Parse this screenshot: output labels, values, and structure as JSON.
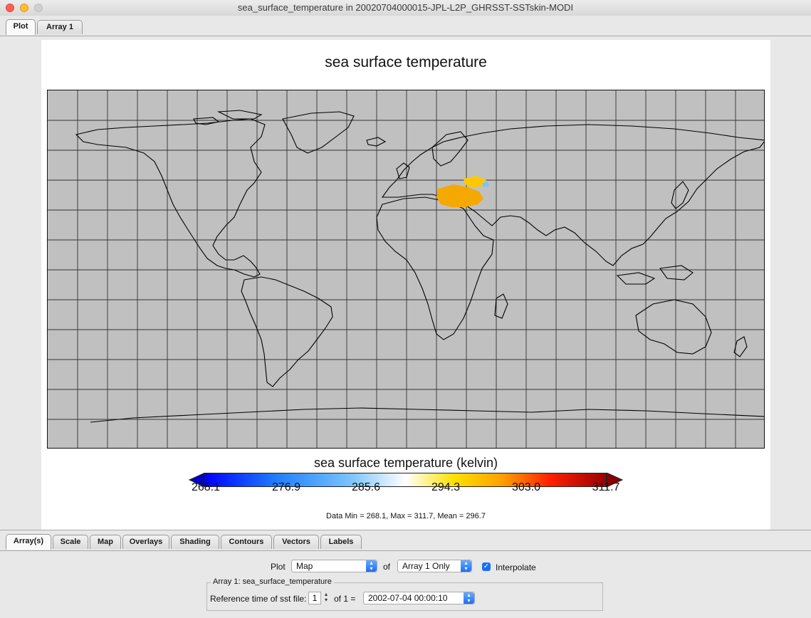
{
  "window": {
    "title": "sea_surface_temperature in 20020704000015-JPL-L2P_GHRSST-SSTskin-MODI"
  },
  "top_tabs": [
    {
      "label": "Plot",
      "active": true
    },
    {
      "label": "Array 1",
      "active": false
    }
  ],
  "plot": {
    "title": "sea surface temperature",
    "colorbar": {
      "title": "sea surface temperature (kelvin)",
      "ticks": [
        "268.1",
        "276.9",
        "285.6",
        "294.3",
        "303.0",
        "311.7"
      ],
      "colors": [
        "#0000ff",
        "#2080ff",
        "#79c3ff",
        "#ffffff",
        "#ffe000",
        "#ffa000",
        "#ff2000",
        "#990000"
      ]
    },
    "stats": "Data Min = 268.1, Max = 311.7, Mean = 296.7"
  },
  "bottom_tabs": [
    {
      "label": "Array(s)",
      "active": true
    },
    {
      "label": "Scale"
    },
    {
      "label": "Map"
    },
    {
      "label": "Overlays"
    },
    {
      "label": "Shading"
    },
    {
      "label": "Contours"
    },
    {
      "label": "Vectors"
    },
    {
      "label": "Labels"
    }
  ],
  "controls": {
    "plot_label": "Plot",
    "plot_type": "Map",
    "of_label": "of",
    "array_choice": "Array 1 Only",
    "interpolate_label": "Interpolate",
    "interpolate_checked": true,
    "group_label": "Array 1: sea_surface_temperature",
    "ref_time_label": "Reference time of sst file:",
    "time_index": "1",
    "of_count": "of 1 =",
    "time_value": "2002-07-04 00:00:10"
  }
}
